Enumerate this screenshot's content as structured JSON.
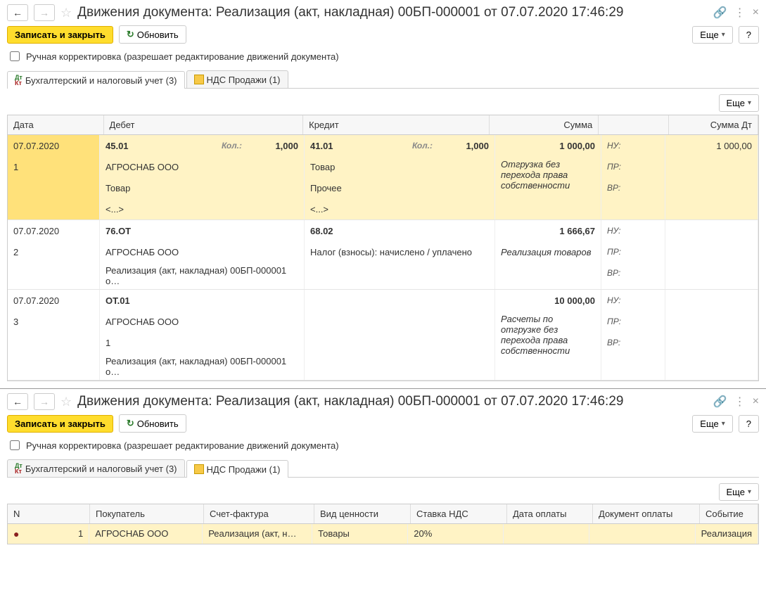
{
  "header": {
    "title": "Движения документа: Реализация (акт, накладная) 00БП-000001 от 07.07.2020 17:46:29"
  },
  "toolbar": {
    "save": "Записать и закрыть",
    "refresh": "Обновить",
    "more": "Еще",
    "help": "?"
  },
  "manual": {
    "label": "Ручная корректировка (разрешает редактирование движений документа)"
  },
  "tabs": {
    "acc": "Бухгалтерский и налоговый учет (3)",
    "vat": "НДС Продажи (1)"
  },
  "cols": {
    "date": "Дата",
    "debit": "Дебет",
    "credit": "Кредит",
    "sum": "Сумма",
    "sumdt": "Сумма Дт",
    "kol": "Кол.:",
    "nu": "НУ:",
    "pr": "ПР:",
    "vr": "ВР:"
  },
  "e1": {
    "date": "07.07.2020",
    "idx": "1",
    "deb_acc": "45.01",
    "deb_qty": "1,000",
    "deb_l1": "АГРОСНАБ ООО",
    "deb_l2": "Товар",
    "deb_l3": "<...>",
    "cred_acc": "41.01",
    "cred_qty": "1,000",
    "cred_l1": "Товар",
    "cred_l2": "Прочее",
    "cred_l3": "<...>",
    "sum": "1 000,00",
    "sumdt": "1 000,00",
    "desc": "Отгрузка без перехода права собственности"
  },
  "e2": {
    "date": "07.07.2020",
    "idx": "2",
    "deb_acc": "76.ОТ",
    "deb_l1": "АГРОСНАБ ООО",
    "deb_l2": "Реализация (акт, накладная) 00БП-000001 о…",
    "cred_acc": "68.02",
    "cred_l1": "Налог (взносы): начислено / уплачено",
    "sum": "1 666,67",
    "desc": "Реализация товаров"
  },
  "e3": {
    "date": "07.07.2020",
    "idx": "3",
    "deb_acc": "ОТ.01",
    "deb_l1": "АГРОСНАБ ООО",
    "deb_l2": "1",
    "deb_l3": "Реализация (акт, накладная) 00БП-000001 о…",
    "sum": "10 000,00",
    "desc": "Расчеты по отгрузке без перехода права собственности"
  },
  "vcols": {
    "n": "N",
    "buyer": "Покупатель",
    "sf": "Счет-фактура",
    "vid": "Вид ценности",
    "rate": "Ставка НДС",
    "paydate": "Дата оплаты",
    "paydoc": "Документ оплаты",
    "event": "Событие"
  },
  "vrow": {
    "n": "1",
    "buyer": "АГРОСНАБ ООО",
    "sf": "Реализация (акт, н…",
    "vid": "Товары",
    "rate": "20%",
    "event": "Реализация"
  }
}
